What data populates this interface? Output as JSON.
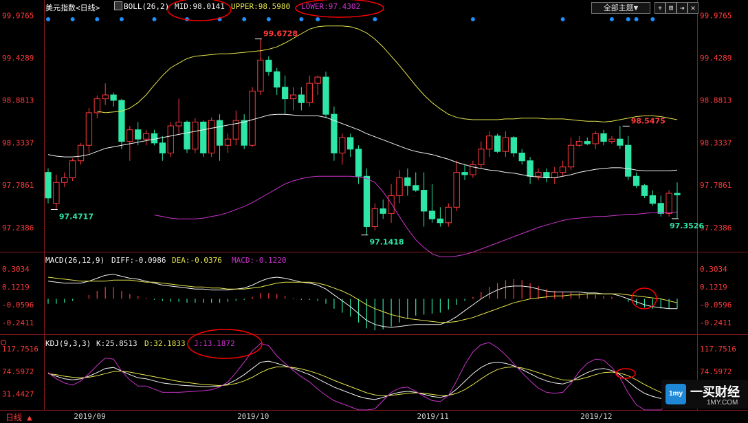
{
  "header": {
    "title": "美元指数<日线>",
    "boll": "BOLL(26,2)",
    "mid": "MID:98.0141",
    "upper": "UPPER:98.5980",
    "lower": "LOWER:97.4302",
    "theme_button": "全部主题▼"
  },
  "macd_header": {
    "label": "MACD(26,12,9)",
    "diff": "DIFF:-0.0986",
    "dea": "DEA:-0.0376",
    "macd": "MACD:-0.1220"
  },
  "kdj_header": {
    "label": "KDJ(9,3,3)",
    "k": "K:25.8513",
    "d": "D:32.1833",
    "j": "J:13.1872"
  },
  "footer": {
    "period": "日线 ▲",
    "dates": [
      "2019/09",
      "2019/10",
      "2019/11",
      "2019/12"
    ]
  },
  "watermark": {
    "badge": "1my",
    "name": "一买财经",
    "url": "1MY.COM"
  },
  "colors": {
    "up": "#ff3b3b",
    "down": "#2ee6a6",
    "mid": "#f5f5f5",
    "upper": "#e6e64c",
    "lower": "#cc33cc",
    "axis": "#ff3b3b",
    "annot": "#ff0000",
    "dots": "#1e90ff"
  },
  "chart_data": [
    {
      "type": "candlestick",
      "title": "美元指数<日线>",
      "y_ticks": [
        "99.9765",
        "99.4289",
        "98.8813",
        "98.3337",
        "97.7861",
        "97.2386"
      ],
      "ylim": [
        97.05,
        99.98
      ],
      "annotations": [
        {
          "text": "99.6728",
          "value": 99.6728,
          "index": 26,
          "color": "#ff3b3b"
        },
        {
          "text": "97.4717",
          "value": 97.4717,
          "index": 1,
          "color": "#2ee6a6"
        },
        {
          "text": "97.1418",
          "value": 97.1418,
          "index": 39,
          "color": "#2ee6a6"
        },
        {
          "text": "98.5475",
          "value": 98.5475,
          "index": 71,
          "color": "#ff3b3b"
        },
        {
          "text": "97.3526",
          "value": 97.3526,
          "index": 77,
          "color": "#2ee6a6"
        }
      ],
      "ohlc": [
        [
          97.95,
          98.0,
          97.55,
          97.62
        ],
        [
          97.55,
          97.92,
          97.47,
          97.82
        ],
        [
          97.82,
          97.95,
          97.76,
          97.88
        ],
        [
          97.88,
          98.13,
          97.84,
          98.1
        ],
        [
          98.1,
          98.33,
          98.05,
          98.3
        ],
        [
          98.3,
          98.78,
          98.2,
          98.72
        ],
        [
          98.72,
          98.94,
          98.65,
          98.9
        ],
        [
          98.9,
          99.1,
          98.82,
          98.95
        ],
        [
          98.95,
          98.98,
          98.8,
          98.88
        ],
        [
          98.88,
          98.9,
          98.25,
          98.35
        ],
        [
          98.35,
          98.55,
          98.1,
          98.5
        ],
        [
          98.5,
          98.6,
          98.3,
          98.38
        ],
        [
          98.38,
          98.5,
          98.3,
          98.45
        ],
        [
          98.45,
          98.5,
          98.3,
          98.33
        ],
        [
          98.33,
          98.42,
          98.1,
          98.2
        ],
        [
          98.2,
          98.6,
          98.15,
          98.55
        ],
        [
          98.55,
          98.9,
          98.45,
          98.6
        ],
        [
          98.6,
          98.62,
          98.2,
          98.25
        ],
        [
          98.25,
          98.65,
          98.2,
          98.6
        ],
        [
          98.6,
          98.62,
          98.15,
          98.2
        ],
        [
          98.2,
          98.66,
          98.15,
          98.62
        ],
        [
          98.62,
          98.7,
          98.1,
          98.3
        ],
        [
          98.3,
          98.45,
          98.2,
          98.38
        ],
        [
          98.38,
          98.75,
          98.3,
          98.62
        ],
        [
          98.62,
          98.7,
          98.25,
          98.3
        ],
        [
          98.3,
          99.05,
          98.28,
          99.0
        ],
        [
          99.0,
          99.67,
          98.95,
          99.4
        ],
        [
          99.4,
          99.45,
          99.2,
          99.25
        ],
        [
          99.25,
          99.3,
          98.95,
          99.05
        ],
        [
          99.05,
          99.2,
          98.7,
          98.9
        ],
        [
          98.9,
          99.05,
          98.75,
          98.95
        ],
        [
          98.95,
          99.05,
          98.75,
          98.85
        ],
        [
          98.85,
          99.2,
          98.8,
          99.1
        ],
        [
          99.1,
          99.2,
          98.95,
          99.18
        ],
        [
          99.18,
          99.25,
          98.65,
          98.7
        ],
        [
          98.7,
          98.8,
          98.1,
          98.2
        ],
        [
          98.2,
          98.45,
          98.05,
          98.4
        ],
        [
          98.4,
          98.45,
          98.15,
          98.25
        ],
        [
          98.25,
          98.3,
          97.8,
          97.9
        ],
        [
          97.9,
          98.0,
          97.14,
          97.25
        ],
        [
          97.25,
          97.55,
          97.2,
          97.48
        ],
        [
          97.48,
          97.6,
          97.35,
          97.42
        ],
        [
          97.42,
          97.8,
          97.3,
          97.65
        ],
        [
          97.65,
          97.98,
          97.55,
          97.88
        ],
        [
          97.88,
          98.0,
          97.65,
          97.78
        ],
        [
          97.78,
          97.95,
          97.7,
          97.72
        ],
        [
          97.72,
          97.95,
          97.25,
          97.45
        ],
        [
          97.45,
          97.8,
          97.3,
          97.35
        ],
        [
          97.35,
          97.5,
          97.25,
          97.3
        ],
        [
          97.3,
          97.55,
          97.25,
          97.5
        ],
        [
          97.5,
          98.1,
          97.45,
          97.95
        ],
        [
          97.95,
          98.05,
          97.85,
          97.92
        ],
        [
          97.92,
          98.1,
          97.88,
          98.05
        ],
        [
          98.05,
          98.35,
          98.0,
          98.25
        ],
        [
          98.25,
          98.48,
          98.15,
          98.42
        ],
        [
          98.42,
          98.45,
          98.2,
          98.22
        ],
        [
          98.22,
          98.48,
          98.15,
          98.4
        ],
        [
          98.4,
          98.42,
          98.15,
          98.2
        ],
        [
          98.2,
          98.25,
          98.05,
          98.1
        ],
        [
          98.1,
          98.15,
          97.8,
          97.9
        ],
        [
          97.9,
          98.0,
          97.85,
          97.95
        ],
        [
          97.95,
          98.0,
          97.82,
          97.88
        ],
        [
          97.88,
          98.02,
          97.8,
          97.95
        ],
        [
          97.95,
          98.1,
          97.9,
          98.02
        ],
        [
          98.02,
          98.4,
          97.98,
          98.3
        ],
        [
          98.3,
          98.42,
          98.28,
          98.35
        ],
        [
          98.35,
          98.4,
          98.3,
          98.32
        ],
        [
          98.32,
          98.48,
          98.25,
          98.45
        ],
        [
          98.45,
          98.5,
          98.3,
          98.35
        ],
        [
          98.35,
          98.42,
          98.32,
          98.38
        ],
        [
          98.38,
          98.55,
          98.25,
          98.3
        ],
        [
          98.3,
          98.42,
          97.85,
          97.9
        ],
        [
          97.9,
          97.95,
          97.75,
          97.78
        ],
        [
          97.78,
          97.8,
          97.62,
          97.65
        ],
        [
          97.65,
          97.72,
          97.52,
          97.55
        ],
        [
          97.55,
          97.65,
          97.38,
          97.42
        ],
        [
          97.42,
          97.72,
          97.38,
          97.68
        ],
        [
          97.68,
          97.82,
          97.36,
          97.66
        ]
      ],
      "mid": [
        98.18,
        98.16,
        98.15,
        98.15,
        98.16,
        98.18,
        98.22,
        98.26,
        98.28,
        98.3,
        98.32,
        98.34,
        98.36,
        98.38,
        98.4,
        98.42,
        98.44,
        98.46,
        98.48,
        98.5,
        98.52,
        98.54,
        98.56,
        98.58,
        98.6,
        98.63,
        98.66,
        98.69,
        98.7,
        98.7,
        98.69,
        98.68,
        98.68,
        98.68,
        98.66,
        98.62,
        98.58,
        98.54,
        98.5,
        98.45,
        98.41,
        98.37,
        98.33,
        98.29,
        98.25,
        98.22,
        98.2,
        98.18,
        98.15,
        98.12,
        98.08,
        98.05,
        98.02,
        98.0,
        97.98,
        97.97,
        97.95,
        97.94,
        97.92,
        97.9,
        97.89,
        97.88,
        97.88,
        97.9,
        97.92,
        97.95,
        97.97,
        97.99,
        98.0,
        98.01,
        98.01,
        98.0,
        97.98,
        97.97,
        97.97,
        97.97,
        97.97,
        97.98
      ],
      "upper": [
        98.74,
        98.72,
        98.73,
        98.74,
        98.78,
        98.85,
        98.95,
        99.08,
        99.2,
        99.3,
        99.36,
        99.42,
        99.45,
        99.46,
        99.47,
        99.48,
        99.48,
        99.49,
        99.5,
        99.51,
        99.52,
        99.54,
        99.57,
        99.62,
        99.68,
        99.74,
        99.8,
        99.83,
        99.84,
        99.84,
        99.84,
        99.83,
        99.8,
        99.75,
        99.67,
        99.57,
        99.45,
        99.33,
        99.2,
        99.07,
        98.95,
        98.85,
        98.77,
        98.7,
        98.66,
        98.64,
        98.63,
        98.63,
        98.63,
        98.63,
        98.64,
        98.64,
        98.65,
        98.65,
        98.65,
        98.64,
        98.64,
        98.64,
        98.63,
        98.62,
        98.61,
        98.61,
        98.6,
        98.61,
        98.63,
        98.65,
        98.67,
        98.68,
        98.68,
        98.67,
        98.65,
        98.63
      ],
      "lower": [
        97.4,
        97.38,
        97.36,
        97.35,
        97.35,
        97.35,
        97.36,
        97.38,
        97.4,
        97.43,
        97.47,
        97.51,
        97.56,
        97.62,
        97.68,
        97.74,
        97.8,
        97.84,
        97.87,
        97.89,
        97.9,
        97.9,
        97.9,
        97.9,
        97.9,
        97.89,
        97.87,
        97.82,
        97.7,
        97.55,
        97.38,
        97.22,
        97.08,
        96.98,
        96.9,
        96.86,
        96.86,
        96.87,
        96.89,
        96.92,
        96.96,
        97.0,
        97.04,
        97.08,
        97.12,
        97.16,
        97.2,
        97.24,
        97.27,
        97.3,
        97.33,
        97.35,
        97.36,
        97.37,
        97.38,
        97.38,
        97.39,
        97.4,
        97.41,
        97.41,
        97.42,
        97.43,
        97.43,
        97.43,
        97.44
      ]
    },
    {
      "type": "bar+line",
      "title": "MACD(26,12,9)",
      "y_ticks": [
        "0.3034",
        "0.1219",
        "-0.0596",
        "-0.2411"
      ],
      "ylim": [
        -0.36,
        0.36
      ],
      "macd_hist": [
        -0.05,
        -0.05,
        -0.04,
        -0.02,
        0.0,
        0.04,
        0.08,
        0.12,
        0.12,
        0.08,
        0.05,
        0.03,
        0.01,
        -0.01,
        -0.02,
        -0.03,
        -0.03,
        -0.04,
        -0.04,
        -0.04,
        -0.04,
        -0.04,
        -0.03,
        -0.02,
        -0.01,
        0.02,
        0.06,
        0.06,
        0.05,
        0.03,
        0.01,
        -0.01,
        -0.01,
        -0.02,
        -0.05,
        -0.1,
        -0.14,
        -0.18,
        -0.24,
        -0.3,
        -0.32,
        -0.31,
        -0.28,
        -0.24,
        -0.2,
        -0.17,
        -0.16,
        -0.15,
        -0.14,
        -0.11,
        -0.06,
        -0.02,
        0.02,
        0.07,
        0.12,
        0.16,
        0.19,
        0.2,
        0.19,
        0.16,
        0.13,
        0.1,
        0.08,
        0.07,
        0.07,
        0.06,
        0.05,
        0.04,
        0.03,
        0.02,
        0.0,
        -0.03,
        -0.06,
        -0.09,
        -0.1,
        -0.1,
        -0.1,
        -0.1
      ],
      "diff": [
        0.18,
        0.17,
        0.16,
        0.16,
        0.16,
        0.18,
        0.21,
        0.24,
        0.25,
        0.23,
        0.21,
        0.2,
        0.18,
        0.16,
        0.14,
        0.13,
        0.12,
        0.11,
        0.1,
        0.1,
        0.09,
        0.09,
        0.09,
        0.1,
        0.11,
        0.14,
        0.18,
        0.21,
        0.22,
        0.21,
        0.19,
        0.17,
        0.16,
        0.14,
        0.1,
        0.04,
        -0.02,
        -0.08,
        -0.15,
        -0.22,
        -0.26,
        -0.28,
        -0.29,
        -0.28,
        -0.27,
        -0.26,
        -0.26,
        -0.26,
        -0.26,
        -0.23,
        -0.18,
        -0.12,
        -0.06,
        0.0,
        0.05,
        0.09,
        0.12,
        0.13,
        0.13,
        0.12,
        0.1,
        0.08,
        0.07,
        0.07,
        0.07,
        0.07,
        0.06,
        0.06,
        0.05,
        0.05,
        0.03,
        0.0,
        -0.03,
        -0.06,
        -0.08,
        -0.09,
        -0.1,
        -0.1
      ],
      "dea": [
        0.22,
        0.21,
        0.2,
        0.19,
        0.18,
        0.18,
        0.18,
        0.18,
        0.19,
        0.19,
        0.19,
        0.18,
        0.17,
        0.17,
        0.16,
        0.15,
        0.14,
        0.13,
        0.12,
        0.12,
        0.11,
        0.11,
        0.1,
        0.1,
        0.1,
        0.11,
        0.12,
        0.14,
        0.16,
        0.17,
        0.17,
        0.17,
        0.17,
        0.16,
        0.14,
        0.11,
        0.08,
        0.04,
        -0.01,
        -0.06,
        -0.1,
        -0.13,
        -0.16,
        -0.18,
        -0.2,
        -0.21,
        -0.22,
        -0.23,
        -0.24,
        -0.24,
        -0.23,
        -0.21,
        -0.19,
        -0.16,
        -0.13,
        -0.1,
        -0.07,
        -0.04,
        -0.02,
        0.0,
        0.01,
        0.02,
        0.03,
        0.03,
        0.04,
        0.04,
        0.05,
        0.05,
        0.05,
        0.05,
        0.05,
        0.04,
        0.03,
        0.02,
        0.01,
        0.0,
        -0.02,
        -0.04
      ]
    },
    {
      "type": "line",
      "title": "KDJ(9,3,3)",
      "y_ticks": [
        "117.7516",
        "74.5972",
        "31.4427"
      ],
      "ylim": [
        0,
        130
      ],
      "k": [
        70,
        65,
        60,
        58,
        60,
        65,
        72,
        80,
        82,
        75,
        68,
        62,
        60,
        56,
        52,
        50,
        48,
        47,
        46,
        45,
        45,
        46,
        50,
        58,
        68,
        80,
        92,
        94,
        90,
        85,
        80,
        74,
        68,
        60,
        52,
        44,
        38,
        32,
        26,
        22,
        20,
        24,
        30,
        34,
        36,
        34,
        30,
        26,
        24,
        28,
        40,
        55,
        70,
        82,
        90,
        92,
        90,
        85,
        78,
        70,
        62,
        56,
        52,
        50,
        55,
        64,
        72,
        78,
        80,
        76,
        68,
        55,
        42,
        32,
        26,
        22,
        24,
        26
      ],
      "d": [
        70,
        68,
        65,
        63,
        62,
        63,
        66,
        70,
        74,
        75,
        73,
        70,
        67,
        64,
        61,
        58,
        55,
        53,
        51,
        49,
        48,
        47,
        48,
        51,
        56,
        63,
        72,
        79,
        83,
        83,
        82,
        79,
        75,
        70,
        64,
        57,
        51,
        45,
        39,
        33,
        29,
        27,
        28,
        30,
        32,
        33,
        32,
        30,
        28,
        28,
        32,
        39,
        49,
        60,
        70,
        78,
        82,
        83,
        81,
        77,
        72,
        67,
        62,
        58,
        57,
        59,
        63,
        68,
        72,
        73,
        71,
        66,
        58,
        49,
        41,
        34,
        30,
        28
      ],
      "j": [
        72,
        60,
        52,
        48,
        56,
        70,
        86,
        100,
        98,
        75,
        58,
        46,
        46,
        40,
        34,
        34,
        34,
        35,
        36,
        37,
        39,
        44,
        54,
        72,
        92,
        114,
        128,
        124,
        104,
        90,
        76,
        64,
        54,
        40,
        28,
        18,
        12,
        6,
        0,
        0,
        2,
        18,
        34,
        42,
        44,
        36,
        26,
        18,
        16,
        28,
        56,
        87,
        112,
        126,
        130,
        120,
        106,
        89,
        72,
        56,
        42,
        34,
        32,
        34,
        51,
        74,
        90,
        98,
        96,
        82,
        62,
        33,
        10,
        0,
        0,
        0,
        12,
        22
      ]
    }
  ]
}
